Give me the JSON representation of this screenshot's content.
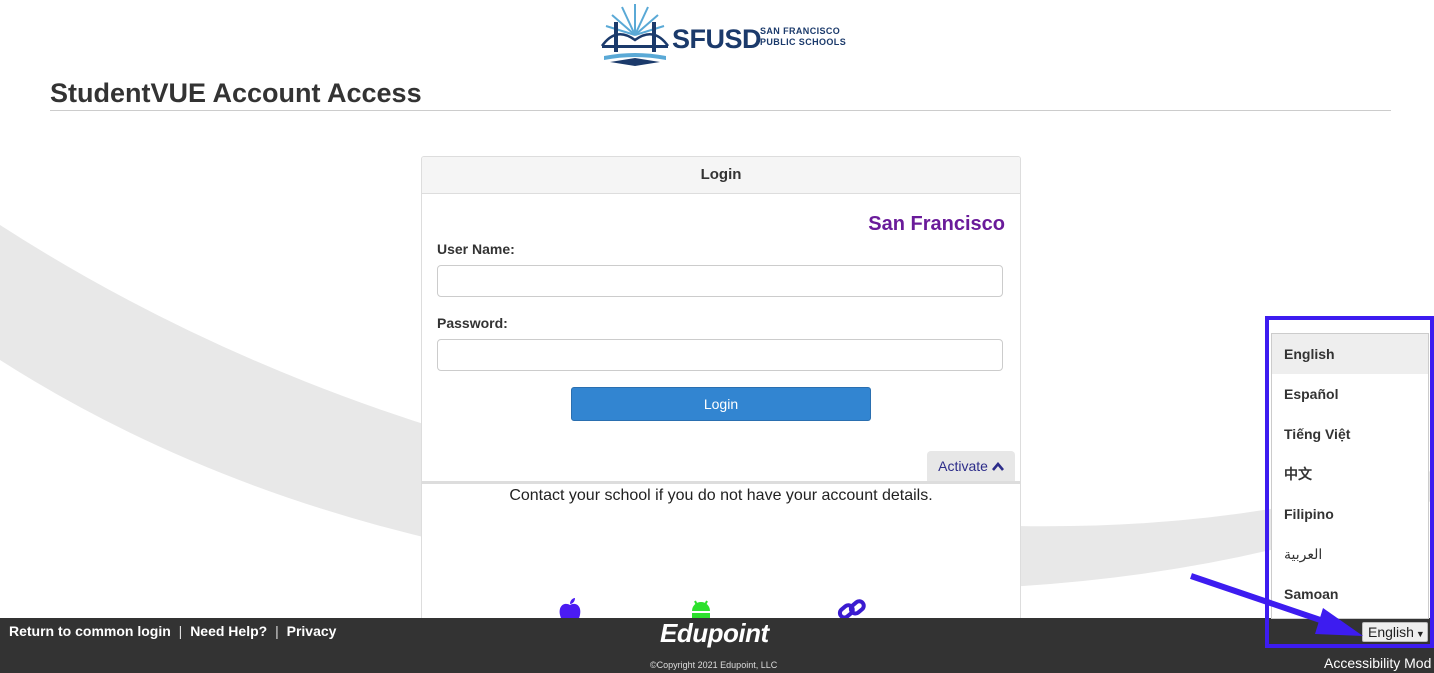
{
  "logo": {
    "text": "SFUSD",
    "sub_line1": "SAN FRANCISCO",
    "sub_line2": "PUBLIC SCHOOLS"
  },
  "page": {
    "title": "StudentVUE Account Access"
  },
  "login_panel": {
    "header": "Login",
    "district": "San Francisco",
    "username_label": "User Name:",
    "username_value": "",
    "password_label": "Password:",
    "password_value": "",
    "login_button": "Login",
    "activate_tab": "Activate",
    "contact_text": "Contact your school if you do not have your account details.",
    "app_icons": [
      "apple-icon",
      "android-icon",
      "link-icon"
    ]
  },
  "footer": {
    "links": [
      "Return to common login",
      "Need Help?",
      "Privacy"
    ],
    "brand": "Edupoint",
    "copyright": "©Copyright 2021 Edupoint, LLC",
    "language_selected": "English",
    "accessibility": "Accessibility Mod"
  },
  "language_menu": {
    "items": [
      "English",
      "Español",
      "Tiếng Việt",
      "中文",
      "Filipino",
      "العربية",
      "Samoan"
    ],
    "active": "English"
  },
  "colors": {
    "district": "#6a1b9a",
    "login_button": "#3285d1",
    "footer_bg": "#333333",
    "highlight": "#3d1cf0"
  }
}
